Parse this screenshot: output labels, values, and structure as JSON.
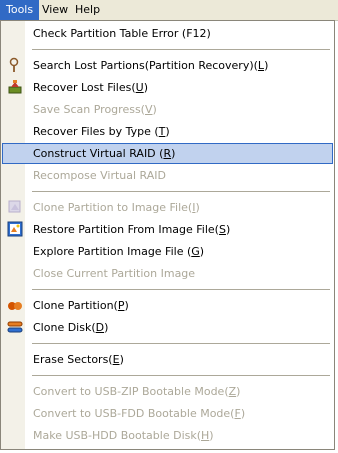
{
  "menubar": {
    "items": [
      {
        "label": "Tools",
        "active": true
      },
      {
        "label": "View",
        "active": false
      },
      {
        "label": "Help",
        "active": false
      }
    ]
  },
  "menu": {
    "items": [
      {
        "type": "item",
        "label": "Check Partition Table Error (F12)",
        "disabled": false
      },
      {
        "type": "sep"
      },
      {
        "type": "item",
        "label_pre": "Search Lost Partions(Partition Recovery)(",
        "accel": "L",
        "label_post": ")",
        "disabled": false,
        "icon": "magnifier-icon"
      },
      {
        "type": "item",
        "label_pre": "Recover Lost Files(",
        "accel": "U",
        "label_post": ")",
        "disabled": false,
        "icon": "recover-files-icon"
      },
      {
        "type": "item",
        "label_pre": "Save Scan Progress(",
        "accel": "V",
        "label_post": ")",
        "disabled": true
      },
      {
        "type": "item",
        "label_pre": "Recover Files by Type (",
        "accel": "T",
        "label_post": ")",
        "disabled": false
      },
      {
        "type": "item",
        "label_pre": "Construct Virtual RAID (",
        "accel": "R",
        "label_post": ")",
        "disabled": false,
        "hover": true
      },
      {
        "type": "item",
        "label": "Recompose Virtual RAID",
        "disabled": true
      },
      {
        "type": "sep"
      },
      {
        "type": "item",
        "label_pre": "Clone Partition to Image File(",
        "accel": "I",
        "label_post": ")",
        "disabled": true,
        "icon": "image-file-icon"
      },
      {
        "type": "item",
        "label_pre": "Restore Partition From Image File(",
        "accel": "S",
        "label_post": ")",
        "disabled": false,
        "icon": "restore-image-icon"
      },
      {
        "type": "item",
        "label_pre": "Explore Partition Image File (",
        "accel": "G",
        "label_post": ")",
        "disabled": false
      },
      {
        "type": "item",
        "label": "Close Current Partition Image",
        "disabled": true
      },
      {
        "type": "sep"
      },
      {
        "type": "item",
        "label_pre": "Clone Partition(",
        "accel": "P",
        "label_post": ")",
        "disabled": false,
        "icon": "clone-partition-icon"
      },
      {
        "type": "item",
        "label_pre": "Clone Disk(",
        "accel": "D",
        "label_post": ")",
        "disabled": false,
        "icon": "clone-disk-icon"
      },
      {
        "type": "sep"
      },
      {
        "type": "item",
        "label_pre": "Erase Sectors(",
        "accel": "E",
        "label_post": ")",
        "disabled": false
      },
      {
        "type": "sep"
      },
      {
        "type": "item",
        "label_pre": "Convert to USB-ZIP Bootable Mode(",
        "accel": "Z",
        "label_post": ")",
        "disabled": true
      },
      {
        "type": "item",
        "label_pre": "Convert to USB-FDD Bootable Mode(",
        "accel": "F",
        "label_post": ")",
        "disabled": true
      },
      {
        "type": "item",
        "label_pre": "Make USB-HDD Bootable Disk(",
        "accel": "H",
        "label_post": ")",
        "disabled": true
      }
    ]
  },
  "colors": {
    "highlight": "#c1d2ee",
    "highlight_border": "#316ac5",
    "disabled_text": "#aca899",
    "menubar_bg": "#ece9d8"
  }
}
